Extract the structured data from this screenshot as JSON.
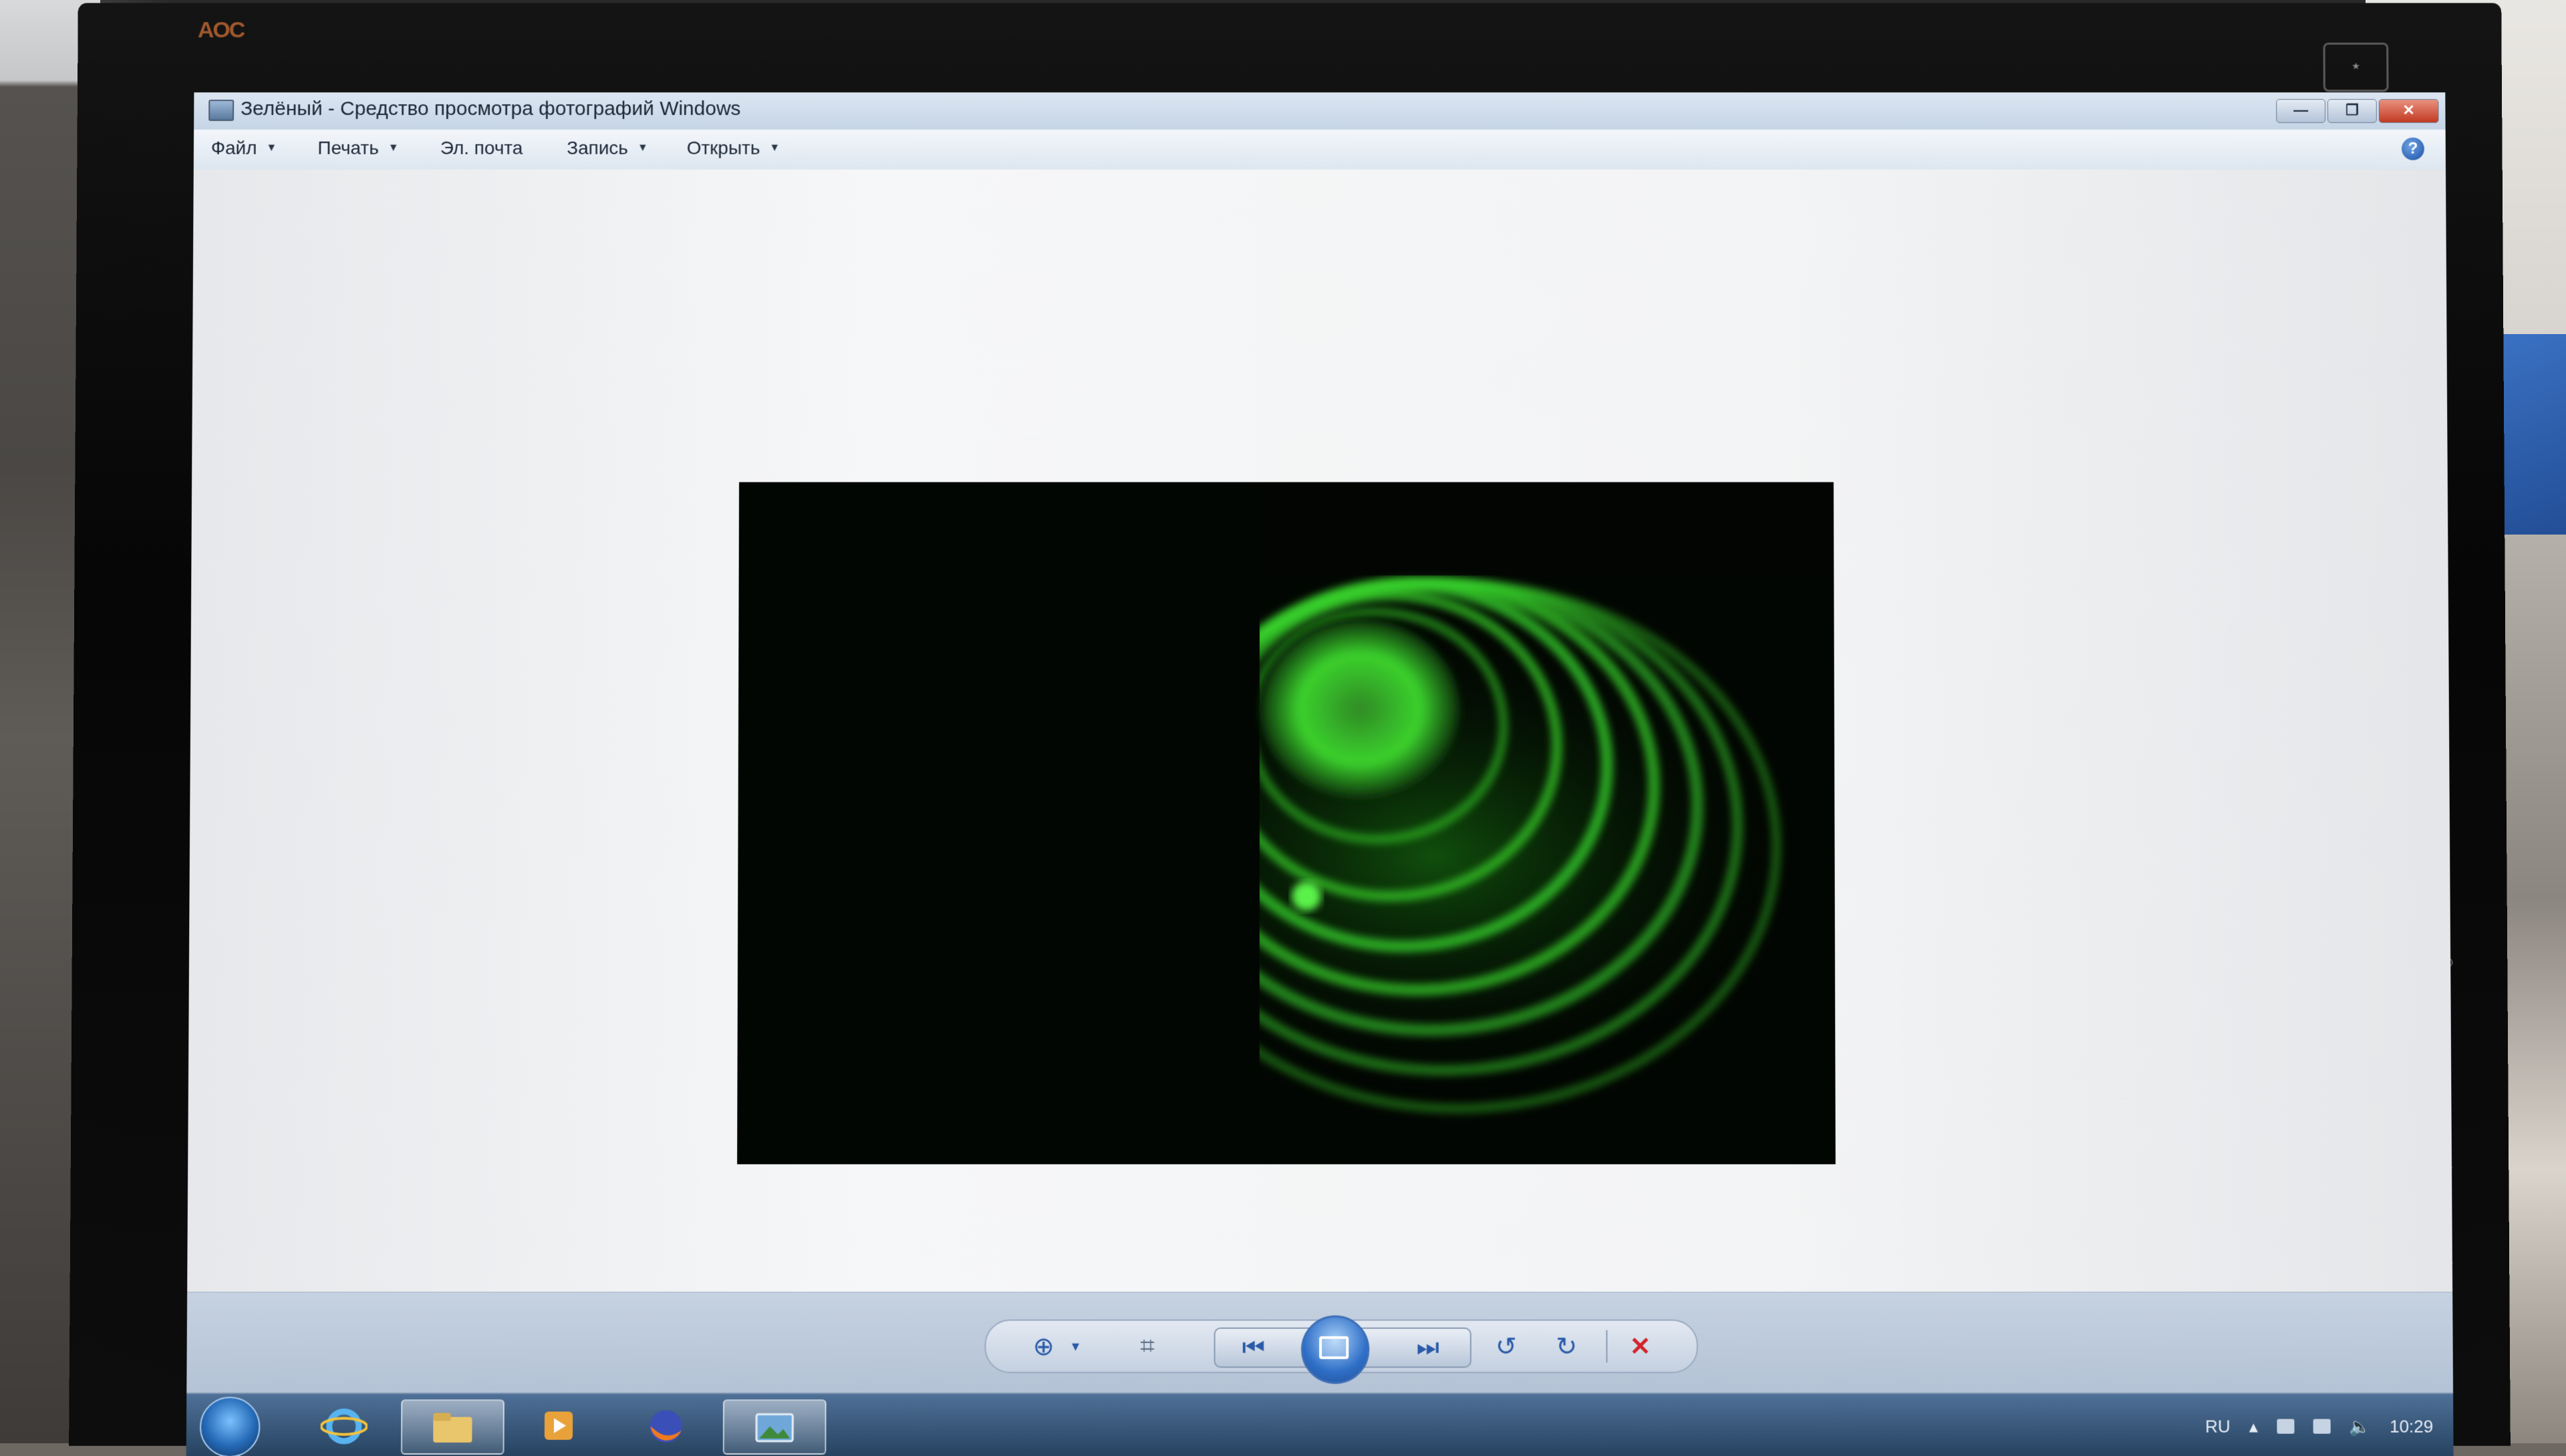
{
  "window": {
    "title": "Зелёный - Средство просмотра фотографий Windows",
    "buttons": {
      "minimize": "—",
      "maximize": "❐",
      "close": "✕"
    }
  },
  "menu": {
    "items": [
      {
        "label": "Файл",
        "has_dropdown": true
      },
      {
        "label": "Печать",
        "has_dropdown": true
      },
      {
        "label": "Эл. почта",
        "has_dropdown": false
      },
      {
        "label": "Запись",
        "has_dropdown": true
      },
      {
        "label": "Открыть",
        "has_dropdown": true
      }
    ],
    "help": "?"
  },
  "photo": {
    "subject": "green laser interference rings",
    "accent_color": "#39d232"
  },
  "controls": {
    "zoom": "⊕",
    "zoom_dropdown": "▾",
    "actual_size": "⌗",
    "previous": "⏮",
    "next": "⏭",
    "rotate_ccw": "↺",
    "rotate_cw": "↻",
    "delete": "✕"
  },
  "taskbar": {
    "language": "RU",
    "clock": "10:29",
    "items": [
      "start",
      "internet-explorer",
      "explorer",
      "media-player",
      "firefox",
      "photo-viewer"
    ]
  },
  "bezel": {
    "logo": "AOC"
  },
  "colors": {
    "window_titlebar": "#c5d4e6",
    "taskbar": "#25425f",
    "close_button": "#c23a22",
    "control_blue": "#2a5aa8"
  }
}
